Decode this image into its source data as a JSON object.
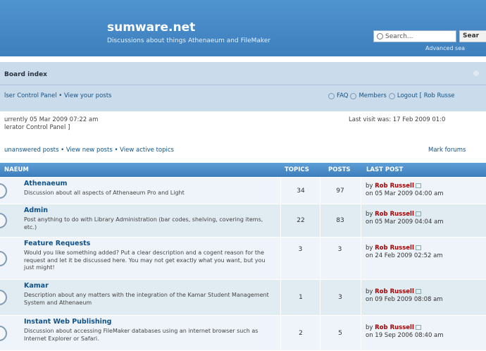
{
  "header": {
    "site_title": "sumware.net",
    "site_description": "Discussions about things Athenaeum and FileMaker",
    "search_placeholder": "Search...",
    "search_button": "Sear",
    "advanced_search": "Advanced sea"
  },
  "navbar": {
    "board_index": "Board index",
    "ucp_links": "lser Control Panel • View your posts",
    "faq": "FAQ",
    "members": "Members",
    "logout": "Logout [ Rob Russe"
  },
  "info": {
    "current_time": "urrently 05 Mar 2009 07:22 am",
    "moderator_panel": "lerator Control Panel ]",
    "last_visit": "Last visit was: 17 Feb 2009 01:0",
    "search_links": "unanswered posts • View new posts • View active topics",
    "mark_read": "Mark forums"
  },
  "table": {
    "headers": {
      "forum": "NAEUM",
      "topics": "TOPICS",
      "posts": "POSTS",
      "last_post": "LAST POST"
    },
    "rows": [
      {
        "title": "Athenaeum",
        "description": "Discussion about all aspects of Athenaeum Pro and Light",
        "topics": "34",
        "posts": "97",
        "by_prefix": "by",
        "author": "Rob Russell",
        "date": "on 05 Mar 2009 04:00 am"
      },
      {
        "title": "Admin",
        "description": "Post anything to do with Library Administration (bar codes, shelving, covering items, etc.)",
        "topics": "22",
        "posts": "83",
        "by_prefix": "by",
        "author": "Rob Russell",
        "date": "on 05 Mar 2009 04:04 am"
      },
      {
        "title": "Feature Requests",
        "description": "Would you like something added? Put a clear description and a cogent reason for the request and let it be discussed here. You may not get exactly what you want, but you just might!",
        "topics": "3",
        "posts": "3",
        "by_prefix": "by",
        "author": "Rob Russell",
        "date": "on 24 Feb 2009 02:52 am"
      },
      {
        "title": "Kamar",
        "description": "Description about any matters with the integration of the Kamar Student Management System and Athenaeum",
        "topics": "1",
        "posts": "3",
        "by_prefix": "by",
        "author": "Rob Russell",
        "date": "on 09 Feb 2009 08:08 am"
      },
      {
        "title": "Instant Web Publishing",
        "description": "Discussion about accessing FileMaker databases using an internet browser such as Internet Explorer or Safari.",
        "topics": "2",
        "posts": "5",
        "by_prefix": "by",
        "author": "Rob Russell",
        "date": "on 19 Sep 2006 08:40 am"
      }
    ]
  }
}
